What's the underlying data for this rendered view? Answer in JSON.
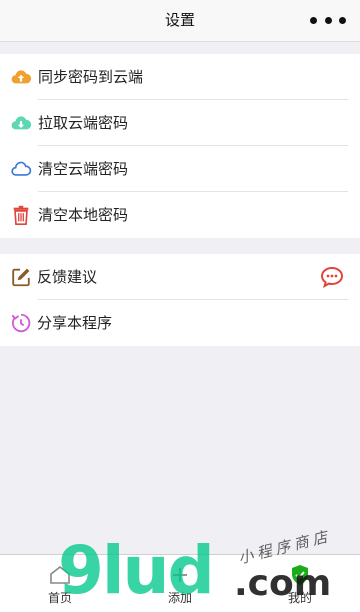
{
  "nav": {
    "title": "设置"
  },
  "settings_group": [
    {
      "label": "同步密码到云端",
      "icon": "cloud-upload-icon",
      "color": "#f0a030"
    },
    {
      "label": "拉取云端密码",
      "icon": "cloud-download-icon",
      "color": "#5fd6b4"
    },
    {
      "label": "清空云端密码",
      "icon": "cloud-outline-icon",
      "color": "#3a78d8"
    },
    {
      "label": "清空本地密码",
      "icon": "trash-icon",
      "color": "#e0443a"
    }
  ],
  "misc_group": [
    {
      "label": "反馈建议",
      "icon": "edit-icon",
      "color": "#8b5a2b"
    },
    {
      "label": "分享本程序",
      "icon": "share-icon",
      "color": "#d05ad8"
    }
  ],
  "tabbar": [
    {
      "label": "首页",
      "icon": "home-icon"
    },
    {
      "label": "添加",
      "icon": "add-icon"
    },
    {
      "label": "我的",
      "icon": "shield-check-icon"
    }
  ],
  "watermark": {
    "brand": "9lud",
    "domain": ".com",
    "tagline": "小程序商店"
  }
}
